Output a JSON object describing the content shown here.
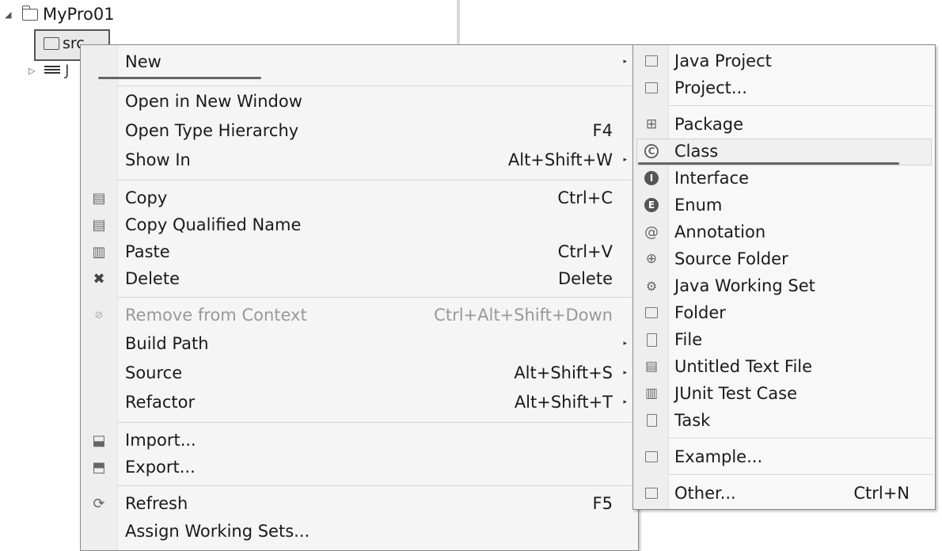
{
  "tree": {
    "project_label": "MyPro01",
    "src_label": "src",
    "jre_label": "J"
  },
  "context_menu": {
    "items": [
      {
        "label": "New",
        "shortcut": "",
        "submenu": true
      },
      {
        "label": "Open in New Window",
        "shortcut": ""
      },
      {
        "label": "Open Type Hierarchy",
        "shortcut": "F4"
      },
      {
        "label": "Show In",
        "shortcut": "Alt+Shift+W",
        "submenu": true
      },
      {
        "label": "Copy",
        "shortcut": "Ctrl+C",
        "icon": "copy-icon"
      },
      {
        "label": "Copy Qualified Name",
        "shortcut": "",
        "icon": "copy-qualified-icon"
      },
      {
        "label": "Paste",
        "shortcut": "Ctrl+V",
        "icon": "paste-icon"
      },
      {
        "label": "Delete",
        "shortcut": "Delete",
        "icon": "delete-icon"
      },
      {
        "label": "Remove from Context",
        "shortcut": "Ctrl+Alt+Shift+Down",
        "icon": "remove-context-icon",
        "disabled": true
      },
      {
        "label": "Build Path",
        "shortcut": "",
        "submenu": true
      },
      {
        "label": "Source",
        "shortcut": "Alt+Shift+S",
        "submenu": true
      },
      {
        "label": "Refactor",
        "shortcut": "Alt+Shift+T",
        "submenu": true
      },
      {
        "label": "Import...",
        "shortcut": "",
        "icon": "import-icon"
      },
      {
        "label": "Export...",
        "shortcut": "",
        "icon": "export-icon"
      },
      {
        "label": "Refresh",
        "shortcut": "F5",
        "icon": "refresh-icon"
      },
      {
        "label": "Assign Working Sets...",
        "shortcut": ""
      }
    ]
  },
  "new_submenu": {
    "items": [
      {
        "label": "Java Project",
        "shortcut": "",
        "icon": "java-project-icon"
      },
      {
        "label": "Project...",
        "shortcut": "",
        "icon": "project-icon"
      },
      {
        "label": "Package",
        "shortcut": "",
        "icon": "package-icon"
      },
      {
        "label": "Class",
        "shortcut": "",
        "icon": "class-icon",
        "highlighted": true
      },
      {
        "label": "Interface",
        "shortcut": "",
        "icon": "interface-icon"
      },
      {
        "label": "Enum",
        "shortcut": "",
        "icon": "enum-icon"
      },
      {
        "label": "Annotation",
        "shortcut": "",
        "icon": "annotation-icon"
      },
      {
        "label": "Source Folder",
        "shortcut": "",
        "icon": "source-folder-icon"
      },
      {
        "label": "Java Working Set",
        "shortcut": "",
        "icon": "working-set-icon"
      },
      {
        "label": "Folder",
        "shortcut": "",
        "icon": "folder-icon"
      },
      {
        "label": "File",
        "shortcut": "",
        "icon": "file-icon"
      },
      {
        "label": "Untitled Text File",
        "shortcut": "",
        "icon": "text-file-icon"
      },
      {
        "label": "JUnit Test Case",
        "shortcut": "",
        "icon": "junit-icon"
      },
      {
        "label": "Task",
        "shortcut": "",
        "icon": "task-icon"
      },
      {
        "label": "Example...",
        "shortcut": "",
        "icon": "example-icon"
      },
      {
        "label": "Other...",
        "shortcut": "Ctrl+N",
        "icon": "other-icon"
      }
    ]
  },
  "glyphs": {
    "expanded": "◢",
    "collapsed": "▷",
    "submenu_arrow": "▸",
    "copy": "▤",
    "delete": "✖",
    "paste": "▥",
    "refresh": "⟳",
    "at": "@",
    "class_letter": "C",
    "interface_letter": "I",
    "enum_letter": "E",
    "import": "⬓",
    "export": "⬒"
  }
}
